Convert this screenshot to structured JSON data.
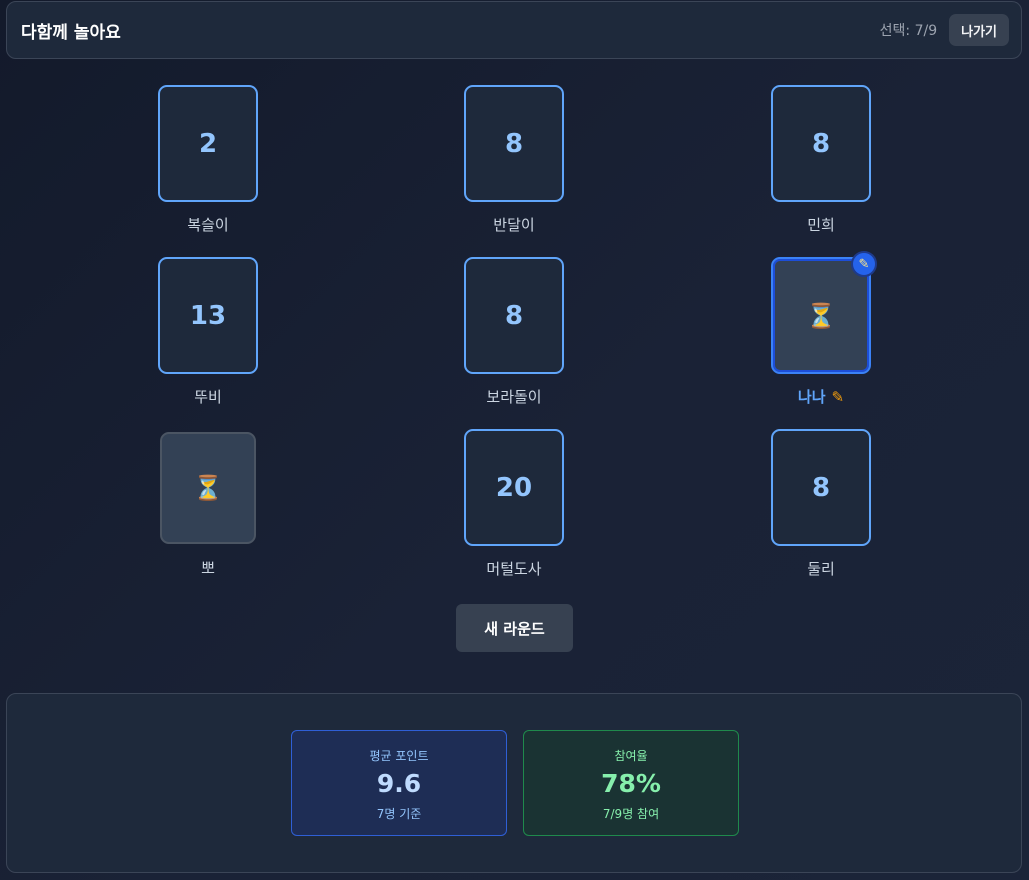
{
  "header": {
    "title": "다함께 놀아요",
    "selection_text": "선택: 7/9",
    "exit_label": "나가기"
  },
  "players": [
    {
      "name": "복슬이",
      "card": "2",
      "status": "revealed"
    },
    {
      "name": "반달이",
      "card": "8",
      "status": "revealed"
    },
    {
      "name": "민희",
      "card": "8",
      "status": "revealed"
    },
    {
      "name": "뚜비",
      "card": "13",
      "status": "revealed"
    },
    {
      "name": "보라돌이",
      "card": "8",
      "status": "revealed"
    },
    {
      "name": "나나",
      "card": "⏳",
      "status": "me-pending",
      "is_me": true
    },
    {
      "name": "뽀",
      "card": "⏳",
      "status": "pending"
    },
    {
      "name": "머털도사",
      "card": "20",
      "status": "revealed"
    },
    {
      "name": "둘리",
      "card": "8",
      "status": "revealed"
    }
  ],
  "icons": {
    "pending": "hourglass-icon",
    "me_badge": "pencil-icon",
    "me_name_marker": "✏️"
  },
  "new_round_label": "새 라운드",
  "stats": {
    "average": {
      "label": "평균 포인트",
      "value": "9.6",
      "sub": "7명 기준"
    },
    "participation": {
      "label": "참여율",
      "value": "78%",
      "sub": "7/9명 참여"
    }
  },
  "colors": {
    "accent": "#60a5fa",
    "card_border": "#60a5fa",
    "participation_green": "#86efac"
  }
}
